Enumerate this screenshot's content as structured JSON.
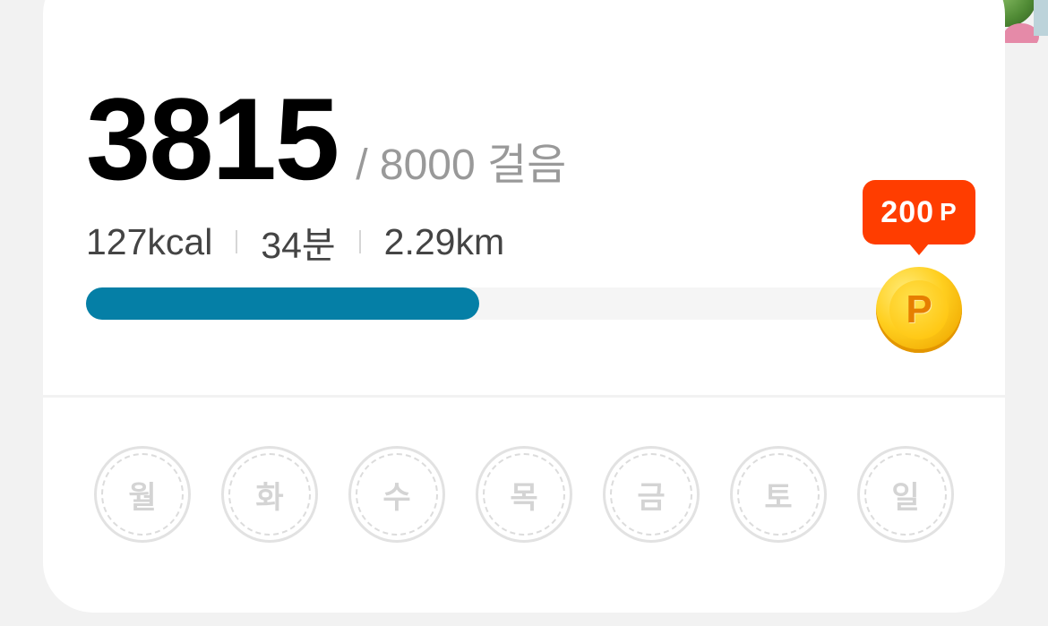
{
  "steps": {
    "current": "3815",
    "goal_text": "/ 8000 걸음",
    "progress_fraction": 0.477
  },
  "stats": {
    "calories": "127kcal",
    "duration": "34분",
    "distance": "2.29km"
  },
  "reward": {
    "amount": "200",
    "unit": "P",
    "coin_symbol": "P"
  },
  "weekdays": [
    "월",
    "화",
    "수",
    "목",
    "금",
    "토",
    "일"
  ],
  "colors": {
    "progress": "#057fa6",
    "badge": "#ff3d00",
    "coin": "#ffcf1f",
    "stamp": "#d4d4d4"
  }
}
